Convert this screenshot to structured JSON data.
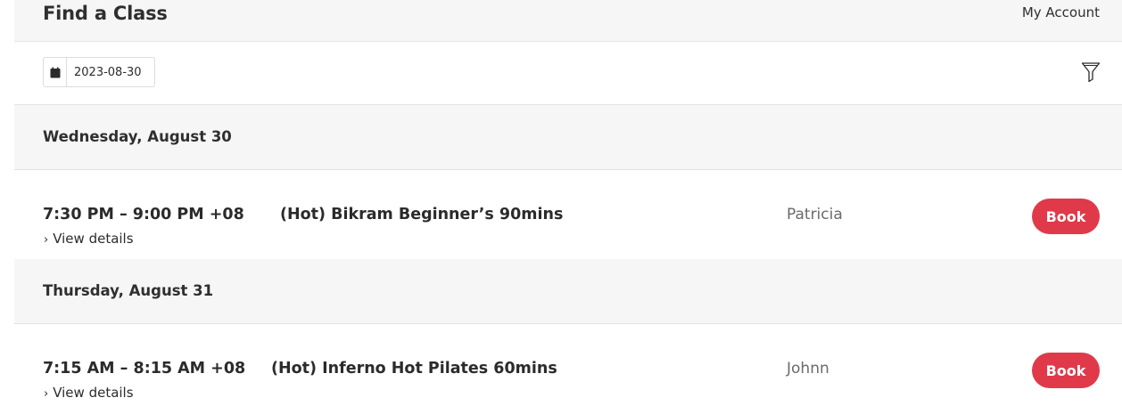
{
  "header": {
    "title": "Find a Class",
    "account_link": "My Account"
  },
  "toolbar": {
    "date_value": "2023-08-30",
    "calendar_icon": "calendar-icon",
    "filter_icon": "filter-icon"
  },
  "days": [
    {
      "label": "Wednesday, August 30",
      "classes": [
        {
          "time": "7:30 PM – 9:00 PM +08",
          "name": "(Hot) Bikram Beginner’s 90mins",
          "instructor": "Patricia",
          "details_label": "View details",
          "book_label": "Book"
        }
      ]
    },
    {
      "label": "Thursday, August 31",
      "classes": [
        {
          "time": "7:15 AM – 8:15 AM +08",
          "name": "(Hot) Inferno Hot Pilates 60mins",
          "instructor": "Johnn",
          "details_label": "View details",
          "book_label": "Book"
        }
      ]
    }
  ],
  "colors": {
    "accent": "#e03a4a",
    "header_bg": "#f6f6f6"
  }
}
